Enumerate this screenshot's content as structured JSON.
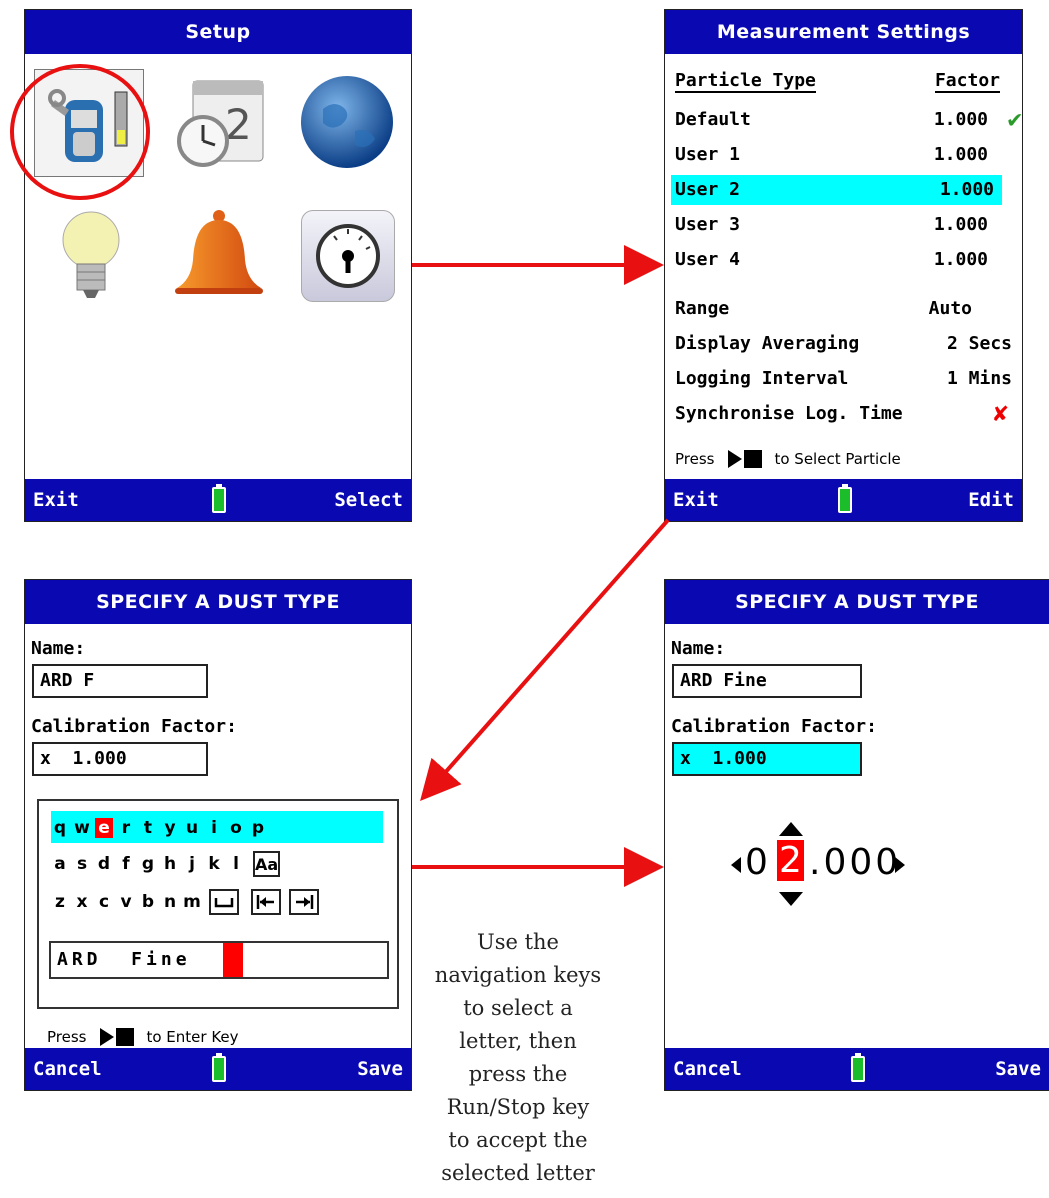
{
  "setup": {
    "title": "Setup",
    "icons": [
      "instrument-settings-icon",
      "date-time-icon",
      "globe-icon",
      "lightbulb-icon",
      "bell-icon",
      "gauge-icon"
    ],
    "exit_label": "Exit",
    "select_label": "Select"
  },
  "measurement": {
    "title": "Measurement Settings",
    "col_particle": "Particle Type",
    "col_factor": "Factor",
    "rows": [
      {
        "name": "Default",
        "factor": "1.000",
        "mark": "✔"
      },
      {
        "name": "User 1",
        "factor": "1.000"
      },
      {
        "name": "User 2",
        "factor": "1.000",
        "selected": true
      },
      {
        "name": "User 3",
        "factor": "1.000"
      },
      {
        "name": "User 4",
        "factor": "1.000"
      }
    ],
    "settings": [
      {
        "label": "Range",
        "value": "Auto"
      },
      {
        "label": "Display Averaging",
        "value": "2 Secs"
      },
      {
        "label": "Logging Interval",
        "value": "1 Mins"
      },
      {
        "label": "Synchronise Log. Time",
        "value": "✘"
      }
    ],
    "press": "Press",
    "press_suffix": "to Select Particle",
    "exit_label": "Exit",
    "edit_label": "Edit"
  },
  "dust_left": {
    "title": "SPECIFY A DUST TYPE",
    "name_label": "Name:",
    "name_value": "ARD F",
    "cal_label": "Calibration Factor:",
    "cal_value": "x  1.000",
    "kb_row1": [
      "q",
      "w",
      "e",
      "r",
      "t",
      "y",
      "u",
      "i",
      "o",
      "p"
    ],
    "kb_row2": [
      "a",
      "s",
      "d",
      "f",
      "g",
      "h",
      "j",
      "k",
      "l"
    ],
    "kb_row2_key": "Aa",
    "kb_row3": [
      "z",
      "x",
      "c",
      "v",
      "b",
      "n",
      "m"
    ],
    "entry": "ARD  Fine",
    "press": "Press",
    "press_suffix": "to Enter Key",
    "cancel_label": "Cancel",
    "save_label": "Save"
  },
  "dust_right": {
    "title": "SPECIFY A DUST TYPE",
    "name_label": "Name:",
    "name_value": "ARD Fine",
    "cal_label": "Calibration Factor:",
    "cal_value": "x  1.000",
    "digit_prefix": "0",
    "digit_selected": "2",
    "digit_suffix": ".000",
    "cancel_label": "Cancel",
    "save_label": "Save"
  },
  "caption": {
    "lines": [
      "Use the",
      "navigation keys",
      "to select a",
      "letter, then",
      "press the",
      "Run/Stop key",
      "to accept the",
      "selected letter"
    ]
  },
  "colors": {
    "title_bar": "#0a08b0",
    "highlight": "#00ffff",
    "selected_key": "#ff0000",
    "arrow": "#e81010",
    "battery": "#1bbd2a"
  }
}
